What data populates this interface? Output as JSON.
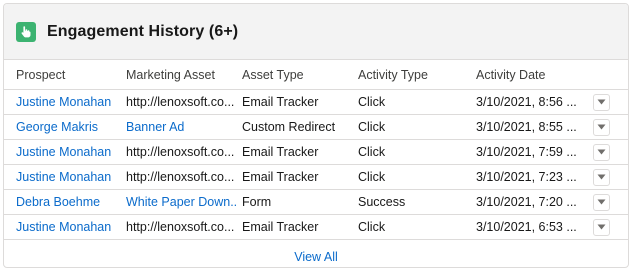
{
  "card": {
    "title": "Engagement History (6+)",
    "icon": "hand-pointer-icon",
    "accent_color": "#3cb371"
  },
  "columns": [
    "Prospect",
    "Marketing Asset",
    "Asset Type",
    "Activity Type",
    "Activity Date"
  ],
  "rows": [
    {
      "prospect": "Justine Monahan",
      "asset": "http://lenoxsoft.co...",
      "asset_type": "Email Tracker",
      "activity_type": "Click",
      "date": "3/10/2021, 8:56 ..."
    },
    {
      "prospect": "George Makris",
      "asset": "Banner Ad",
      "asset_type": "Custom Redirect",
      "activity_type": "Click",
      "date": "3/10/2021, 8:55 ..."
    },
    {
      "prospect": "Justine Monahan",
      "asset": "http://lenoxsoft.co...",
      "asset_type": "Email Tracker",
      "activity_type": "Click",
      "date": "3/10/2021, 7:59 ..."
    },
    {
      "prospect": "Justine Monahan",
      "asset": "http://lenoxsoft.co...",
      "asset_type": "Email Tracker",
      "activity_type": "Click",
      "date": "3/10/2021, 7:23 ..."
    },
    {
      "prospect": "Debra Boehme",
      "asset": "White Paper Down...",
      "asset_type": "Form",
      "activity_type": "Success",
      "date": "3/10/2021, 7:20 ..."
    },
    {
      "prospect": "Justine Monahan",
      "asset": "http://lenoxsoft.co...",
      "asset_type": "Email Tracker",
      "activity_type": "Click",
      "date": "3/10/2021, 6:53 ..."
    }
  ],
  "footer": {
    "view_all": "View All"
  },
  "colors": {
    "link": "#0b6bcb",
    "border": "#dddbda",
    "header_bg": "#f3f3f3"
  }
}
